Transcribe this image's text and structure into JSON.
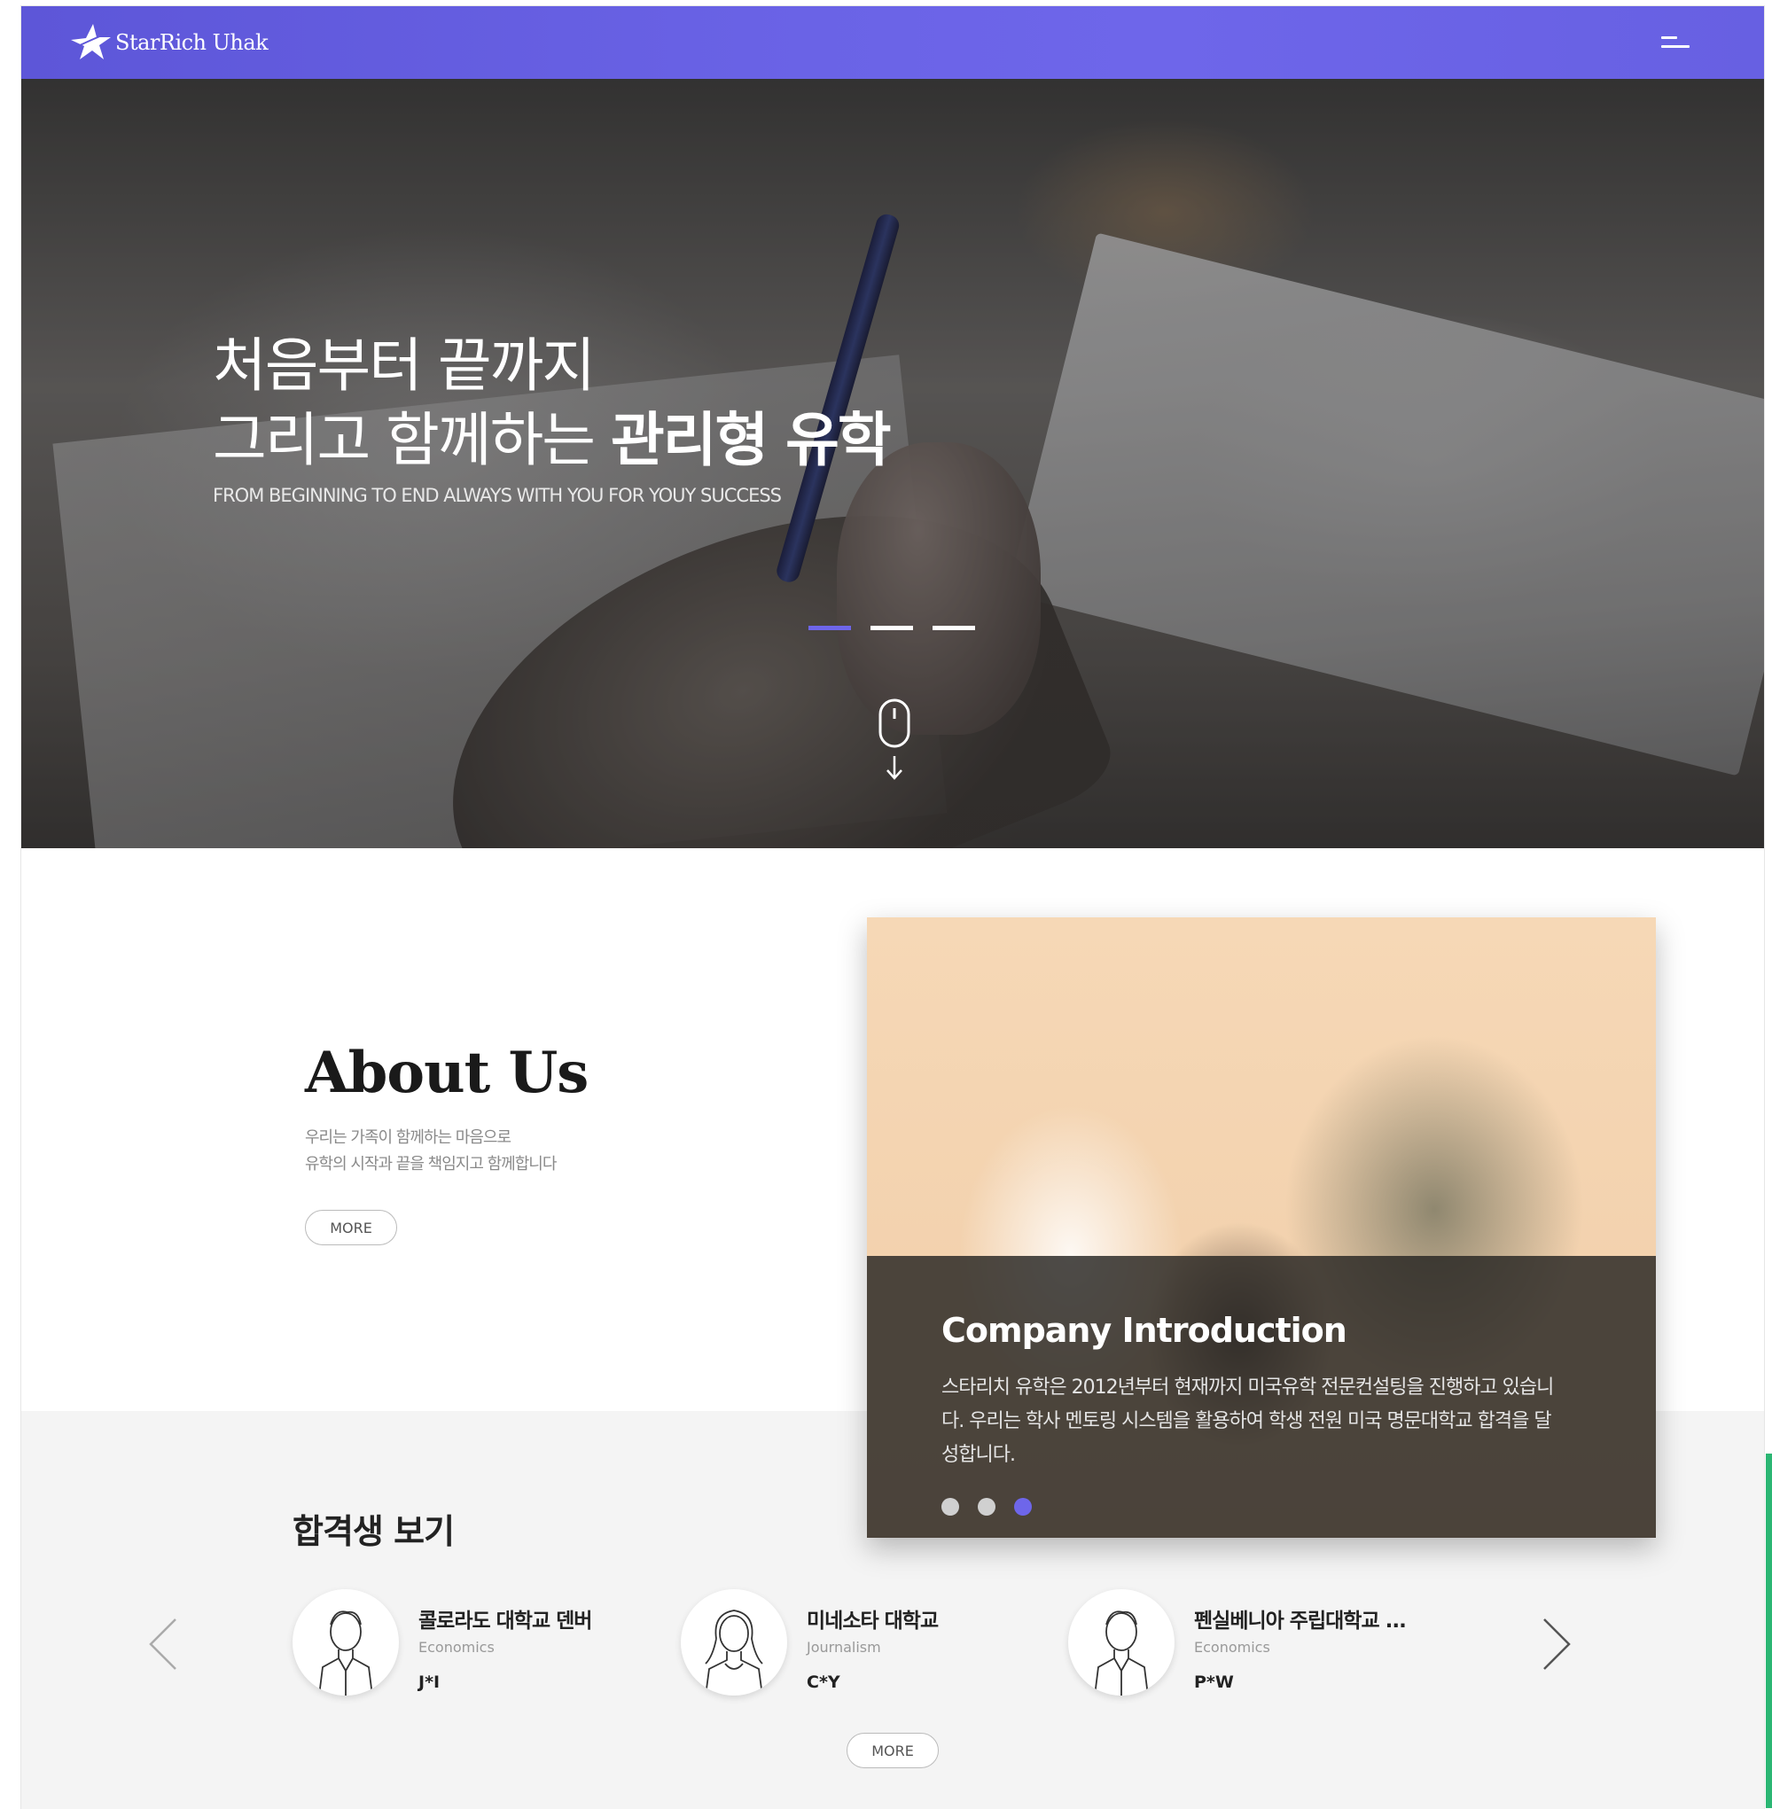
{
  "header": {
    "logo_text": "StarRich Uhak",
    "menu_icon": "hamburger-menu-icon"
  },
  "hero": {
    "title_line1": "처음부터 끝까지",
    "title_line2_prefix": "그리고 함께하는 ",
    "title_line2_bold": "관리형 유학",
    "subtitle": "FROM BEGINNING TO END ALWAYS WITH YOU FOR YOUY SUCCESS",
    "active_slide": 1,
    "slide_count": 3,
    "scroll_icon": "mouse-scroll-icon"
  },
  "about": {
    "title": "About Us",
    "desc_line1": "우리는 가족이 함께하는 마음으로",
    "desc_line2": "유학의 시작과 끝을 책임지고 함께합니다",
    "more_label": "MORE"
  },
  "company": {
    "title": "Company Introduction",
    "text": "스타리치 유학은 2012년부터 현재까지 미국유학 전문컨설팅을 진행하고 있습니다. 우리는 학사 멘토링 시스템을 활용하여 학생 전원 미국 명문대학교 합격을 달성합니다.",
    "active_slide": 3,
    "slide_count": 3
  },
  "graduates": {
    "title": "합격생 보기",
    "items": [
      {
        "school": "콜로라도 대학교 덴버",
        "major": "Economics",
        "name": "J*I",
        "avatar": "male-avatar-icon"
      },
      {
        "school": "미네소타 대학교",
        "major": "Journalism",
        "name": "C*Y",
        "avatar": "female-avatar-icon"
      },
      {
        "school": "펜실베니아 주립대학교 ...",
        "major": "Economics",
        "name": "P*W",
        "avatar": "male-avatar-icon"
      }
    ],
    "more_label": "MORE",
    "prev_icon": "chevron-left-icon",
    "next_icon": "chevron-right-icon"
  },
  "colors": {
    "accent": "#6e66ea",
    "header_start": "#5d56d8",
    "band": "#f4f4f4"
  }
}
